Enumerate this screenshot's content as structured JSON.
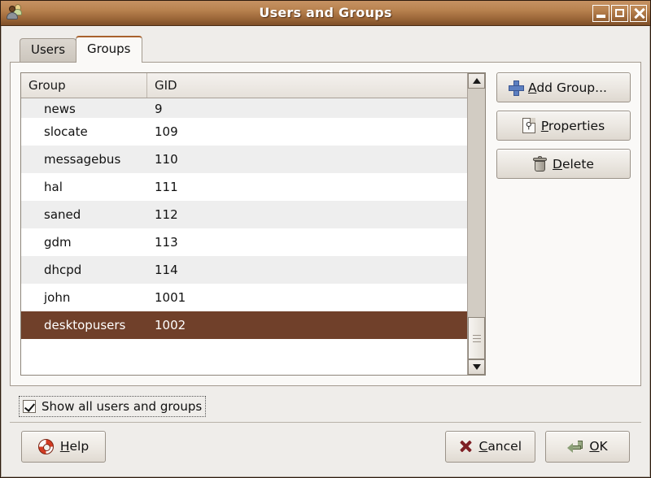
{
  "window": {
    "title": "Users and Groups",
    "icon": "users-icon",
    "controls": {
      "minimize": "minimize-icon",
      "maximize": "maximize-icon",
      "close": "close-icon"
    }
  },
  "tabs": [
    {
      "label": "Users",
      "active": false
    },
    {
      "label": "Groups",
      "active": true
    }
  ],
  "list": {
    "columns": [
      "Group",
      "GID"
    ],
    "rows": [
      {
        "group": "news",
        "gid": "9",
        "selected": false
      },
      {
        "group": "slocate",
        "gid": "109",
        "selected": false
      },
      {
        "group": "messagebus",
        "gid": "110",
        "selected": false
      },
      {
        "group": "hal",
        "gid": "111",
        "selected": false
      },
      {
        "group": "saned",
        "gid": "112",
        "selected": false
      },
      {
        "group": "gdm",
        "gid": "113",
        "selected": false
      },
      {
        "group": "dhcpd",
        "gid": "114",
        "selected": false
      },
      {
        "group": "john",
        "gid": "1001",
        "selected": false
      },
      {
        "group": "desktopusers",
        "gid": "1002",
        "selected": true
      }
    ],
    "scrollbar": {
      "position": "bottom"
    }
  },
  "side_buttons": {
    "add_group": "Add Group...",
    "properties": "Properties",
    "delete": "Delete"
  },
  "options": {
    "show_all_label": "Show all users and groups",
    "show_all_checked": true
  },
  "actions": {
    "help": "Help",
    "cancel": "Cancel",
    "ok": "OK"
  },
  "colors": {
    "titlebar_light": "#c69263",
    "titlebar_dark": "#7e4f28",
    "selection": "#70402a",
    "active_tab_accent": "#a9622e",
    "window_bg": "#efedea",
    "page_bg": "#faf9f7"
  }
}
